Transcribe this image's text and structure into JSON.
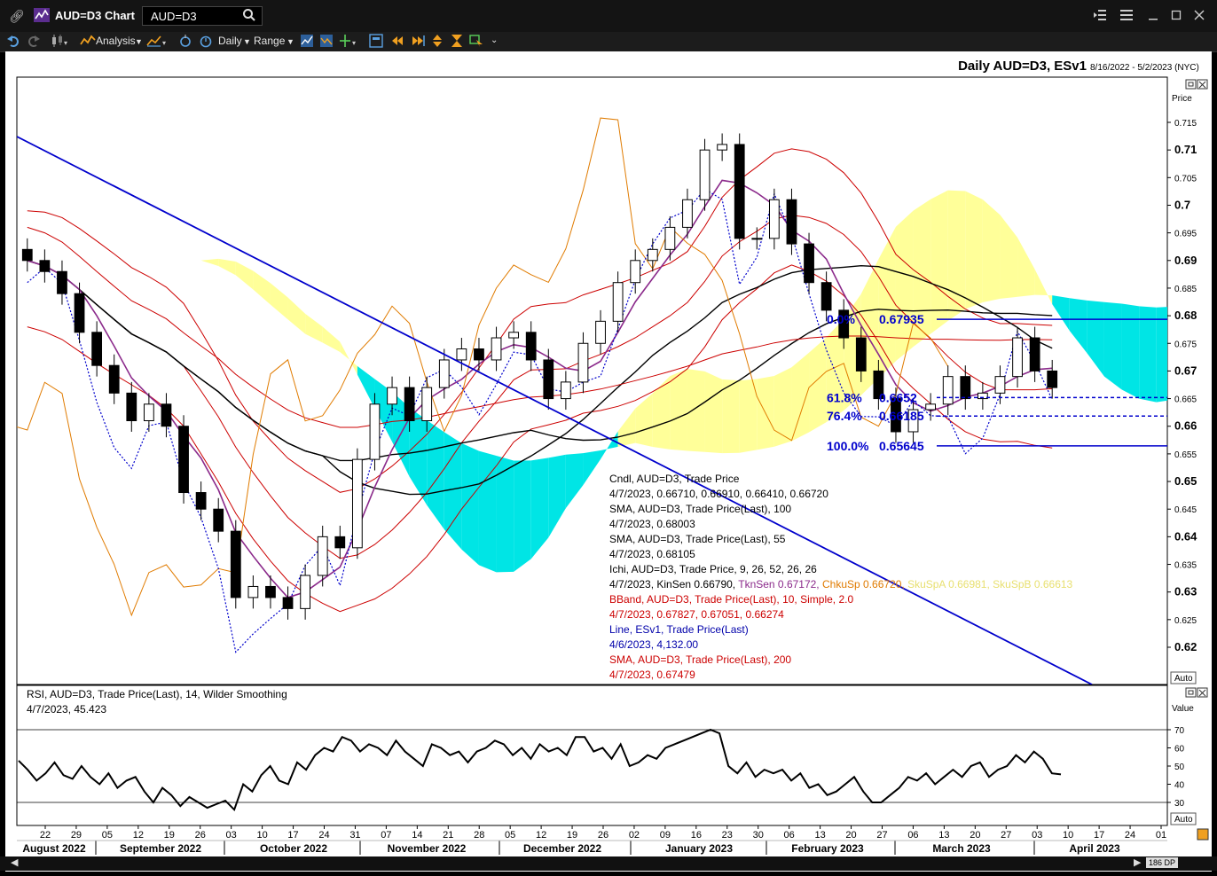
{
  "window": {
    "title": "AUD=D3 Chart",
    "search_value": "AUD=D3"
  },
  "toolbar": {
    "analysis_label": "Analysis",
    "interval_label": "Daily",
    "range_label": "Range"
  },
  "header": {
    "title": "Daily AUD=D3, ESv1",
    "range": "8/16/2022 - 5/2/2023 (NYC)"
  },
  "price_axis": {
    "title": "Price",
    "auto_label": "Auto",
    "ticks": [
      "0.715",
      "0.71",
      "0.705",
      "0.7",
      "0.695",
      "0.69",
      "0.685",
      "0.68",
      "0.675",
      "0.67",
      "0.665",
      "0.66",
      "0.655",
      "0.65",
      "0.645",
      "0.64",
      "0.635",
      "0.63",
      "0.625",
      "0.62"
    ]
  },
  "rsi_axis": {
    "title": "Value",
    "auto_label": "Auto",
    "ticks": [
      "70",
      "60",
      "50",
      "40",
      "30"
    ]
  },
  "time_axis": {
    "days": [
      "22",
      "29",
      "05",
      "12",
      "19",
      "26",
      "03",
      "10",
      "17",
      "24",
      "31",
      "07",
      "14",
      "21",
      "28",
      "05",
      "12",
      "19",
      "26",
      "02",
      "09",
      "16",
      "23",
      "30",
      "06",
      "13",
      "20",
      "27",
      "06",
      "13",
      "20",
      "27",
      "03",
      "10",
      "17",
      "24",
      "01"
    ],
    "months": [
      "August 2022",
      "September 2022",
      "October 2022",
      "November 2022",
      "December 2022",
      "January 2023",
      "February 2023",
      "March 2023",
      "April 2023"
    ]
  },
  "legend": [
    {
      "text": "Cndl, AUD=D3, Trade Price",
      "color": "#000000"
    },
    {
      "text": "4/7/2023, 0.66710, 0.66910, 0.66410, 0.66720",
      "color": "#000000"
    },
    {
      "text": "SMA, AUD=D3, Trade Price(Last),  100",
      "color": "#000000"
    },
    {
      "text": "4/7/2023, 0.68003",
      "color": "#000000"
    },
    {
      "text": "SMA, AUD=D3, Trade Price(Last),  55",
      "color": "#000000"
    },
    {
      "text": "4/7/2023, 0.68105",
      "color": "#000000"
    },
    {
      "text": "Ichi, AUD=D3, Trade Price,  9, 26, 52, 26, 26",
      "color": "#000000"
    },
    {
      "text": "BBand, AUD=D3, Trade Price(Last),  10, Simple, 2.0",
      "color": "#cc0000"
    },
    {
      "text": "4/7/2023, 0.67827, 0.67051, 0.66274",
      "color": "#cc0000"
    },
    {
      "text": "Line, ESv1, Trade Price(Last)",
      "color": "#0000aa"
    },
    {
      "text": "4/6/2023, 4,132.00",
      "color": "#0000aa"
    },
    {
      "text": "SMA, AUD=D3, Trade Price(Last),  200",
      "color": "#cc0000"
    },
    {
      "text": "4/7/2023, 0.67479",
      "color": "#cc0000"
    }
  ],
  "ichi_values": {
    "date": "4/7/2023,",
    "kijun": "KinSen 0.66790,",
    "tenkan": "TknSen 0.67172,",
    "chikou": "ChkuSp 0.66720,",
    "senkou_a": "SkuSpA 0.66981,",
    "senkou_b": "SkuSpB 0.66613"
  },
  "fibonacci": [
    {
      "label": "0.0%",
      "value": "0.67935"
    },
    {
      "label": "61.8%",
      "value": "0.6652"
    },
    {
      "label": "76.4%",
      "value": "0.66185"
    },
    {
      "label": "100.0%",
      "value": "0.65645"
    }
  ],
  "rsi_legend": {
    "line1": "RSI, AUD=D3, Trade Price(Last),  14, Wilder Smoothing",
    "line2": "4/7/2023, 45.423"
  },
  "nav": {
    "dp_label": "186 DP"
  },
  "colors": {
    "cloud_bear": "#00e5e5",
    "cloud_bull": "#ffff99",
    "sma": "#000000",
    "bband": "#cc0000",
    "chikou": "#e07b00",
    "fib": "#0000cc",
    "tenkan": "#8b2a8b"
  },
  "chart_data": [
    {
      "type": "line",
      "title": "Daily AUD=D3, ESv1",
      "ylabel": "Price",
      "ylim": [
        0.6165,
        0.7185
      ],
      "x_labels": [
        "August 2022",
        "September 2022",
        "October 2022",
        "November 2022",
        "December 2022",
        "January 2023",
        "February 2023",
        "March 2023",
        "April 2023"
      ],
      "series": [
        {
          "name": "AUD=D3",
          "values": [
            0.69,
            0.688,
            0.684,
            0.677,
            0.671,
            0.666,
            0.661,
            0.664,
            0.66,
            0.648,
            0.645,
            0.641,
            0.629,
            0.631,
            0.629,
            0.627,
            0.633,
            0.64,
            0.638,
            0.654,
            0.664,
            0.667,
            0.661,
            0.667,
            0.672,
            0.674,
            0.672,
            0.676,
            0.677,
            0.672,
            0.665,
            0.668,
            0.675,
            0.679,
            0.686,
            0.69,
            0.692,
            0.696,
            0.701,
            0.71,
            0.711,
            0.694,
            0.694,
            0.701,
            0.693,
            0.686,
            0.681,
            0.676,
            0.67,
            0.665,
            0.659,
            0.663,
            0.664,
            0.669,
            0.665,
            0.666,
            0.669,
            0.676,
            0.67,
            0.667
          ]
        }
      ],
      "last": {
        "date": "4/7/2023",
        "open": 0.6671,
        "high": 0.6691,
        "low": 0.6641,
        "close": 0.6672
      },
      "fibonacci_levels": [
        0.67935,
        0.6652,
        0.66185,
        0.65645
      ]
    },
    {
      "type": "line",
      "title": "RSI, AUD=D3, Trade Price(Last),  14, Wilder Smoothing",
      "ylabel": "Value",
      "ylim": [
        22,
        74
      ],
      "series": [
        {
          "name": "RSI",
          "values": [
            53,
            48,
            42,
            46,
            52,
            45,
            43,
            50,
            44,
            40,
            46,
            38,
            42,
            44,
            36,
            30,
            38,
            34,
            28,
            33,
            30,
            27,
            29,
            31,
            26,
            40,
            36,
            45,
            50,
            42,
            40,
            52,
            48,
            56,
            60,
            58,
            66,
            64,
            58,
            62,
            60,
            56,
            64,
            58,
            54,
            50,
            62,
            60,
            56,
            58,
            52,
            58,
            60,
            64,
            62,
            56,
            60,
            54,
            62,
            58,
            60,
            56,
            66,
            66,
            58,
            60,
            54,
            62,
            50,
            52,
            56,
            54,
            60,
            62,
            64,
            66,
            68,
            70,
            68,
            50,
            46,
            52,
            44,
            48,
            46,
            48,
            42,
            46,
            38,
            40,
            34,
            36,
            40,
            44,
            36,
            30,
            30,
            34,
            38,
            44,
            42,
            46,
            40,
            44,
            48,
            44,
            50,
            52,
            44,
            48,
            50,
            56,
            52,
            58,
            54,
            46,
            45.4
          ]
        }
      ],
      "reference_lines": [
        70,
        30
      ],
      "last": {
        "date": "4/7/2023",
        "value": 45.423
      }
    }
  ]
}
